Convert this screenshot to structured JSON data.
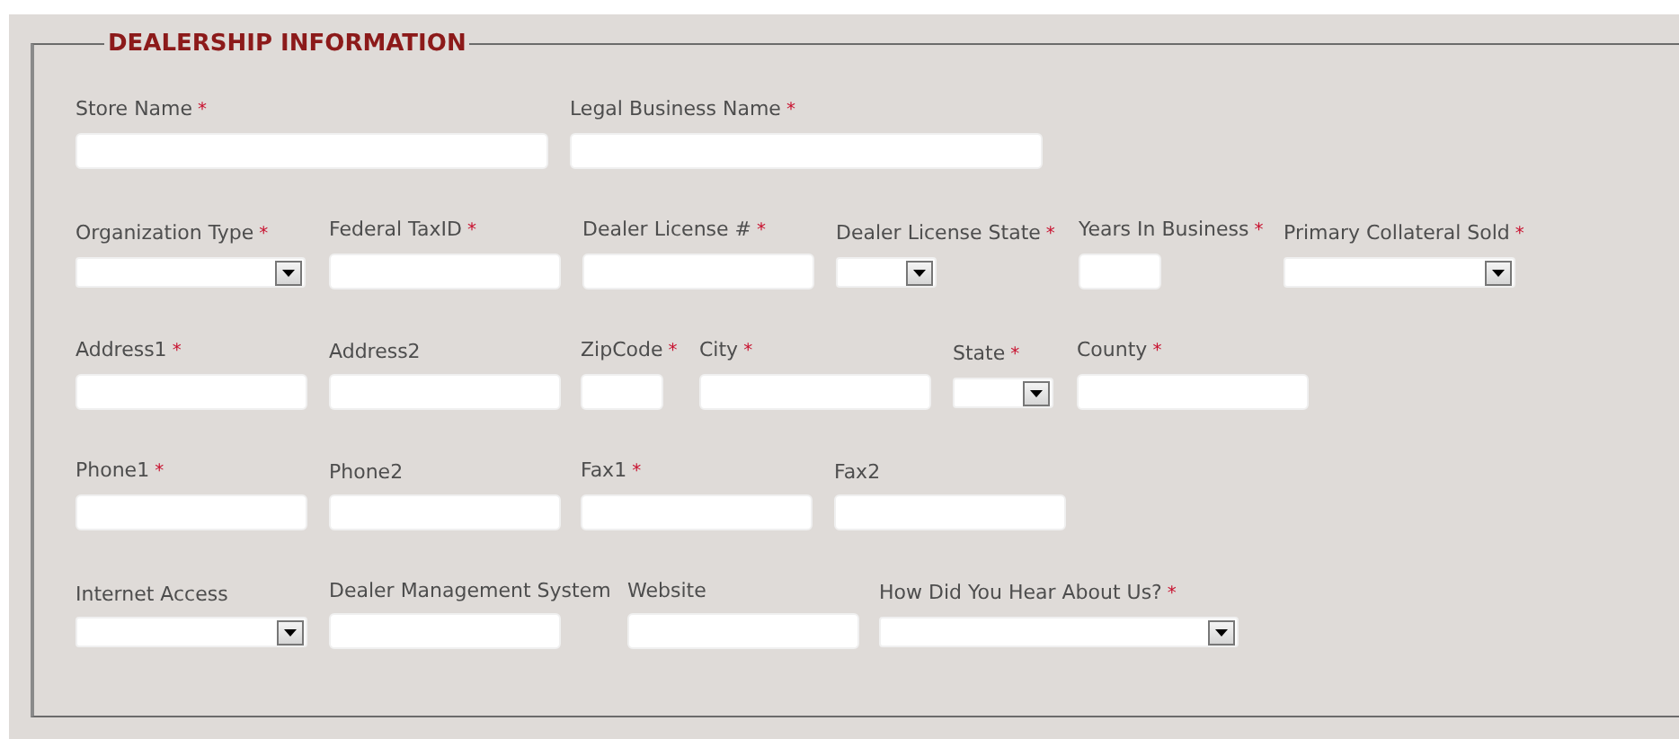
{
  "section": {
    "title": "DEALERSHIP INFORMATION",
    "rows": [
      {
        "fields": [
          {
            "label": "Store Name",
            "required_mark": "*",
            "kind": "text"
          },
          {
            "label": "Legal Business Name",
            "required_mark": "*",
            "kind": "text"
          }
        ]
      },
      {
        "fields": [
          {
            "label": "Organization Type",
            "required_mark": "*",
            "kind": "select"
          },
          {
            "label": "Federal TaxID",
            "required_mark": "*",
            "kind": "text"
          },
          {
            "label": "Dealer License #",
            "required_mark": "*",
            "kind": "text"
          },
          {
            "label": "Dealer License State",
            "required_mark": "*",
            "kind": "select"
          },
          {
            "label": "Years In Business",
            "required_mark": "*",
            "kind": "text"
          },
          {
            "label": "Primary Collateral Sold",
            "required_mark": "*",
            "kind": "select"
          }
        ]
      },
      {
        "fields": [
          {
            "label": "Address1",
            "required_mark": "*",
            "kind": "text"
          },
          {
            "label": "Address2",
            "kind": "text"
          },
          {
            "label": "ZipCode",
            "required_mark": "*",
            "kind": "text"
          },
          {
            "label": "City",
            "required_mark": "*",
            "kind": "text"
          },
          {
            "label": "State",
            "required_mark": "*",
            "kind": "select"
          },
          {
            "label": "County",
            "required_mark": "*",
            "kind": "text"
          }
        ]
      },
      {
        "fields": [
          {
            "label": "Phone1",
            "required_mark": "*",
            "kind": "text"
          },
          {
            "label": "Phone2",
            "kind": "text"
          },
          {
            "label": "Fax1",
            "required_mark": "*",
            "kind": "text"
          },
          {
            "label": "Fax2",
            "kind": "text"
          }
        ]
      },
      {
        "fields": [
          {
            "label": "Internet Access",
            "kind": "select"
          },
          {
            "label": "Dealer Management System",
            "kind": "text"
          },
          {
            "label": "Website",
            "kind": "text"
          },
          {
            "label": "How Did You Hear About Us?",
            "required_mark": "*",
            "kind": "select"
          }
        ]
      }
    ]
  }
}
